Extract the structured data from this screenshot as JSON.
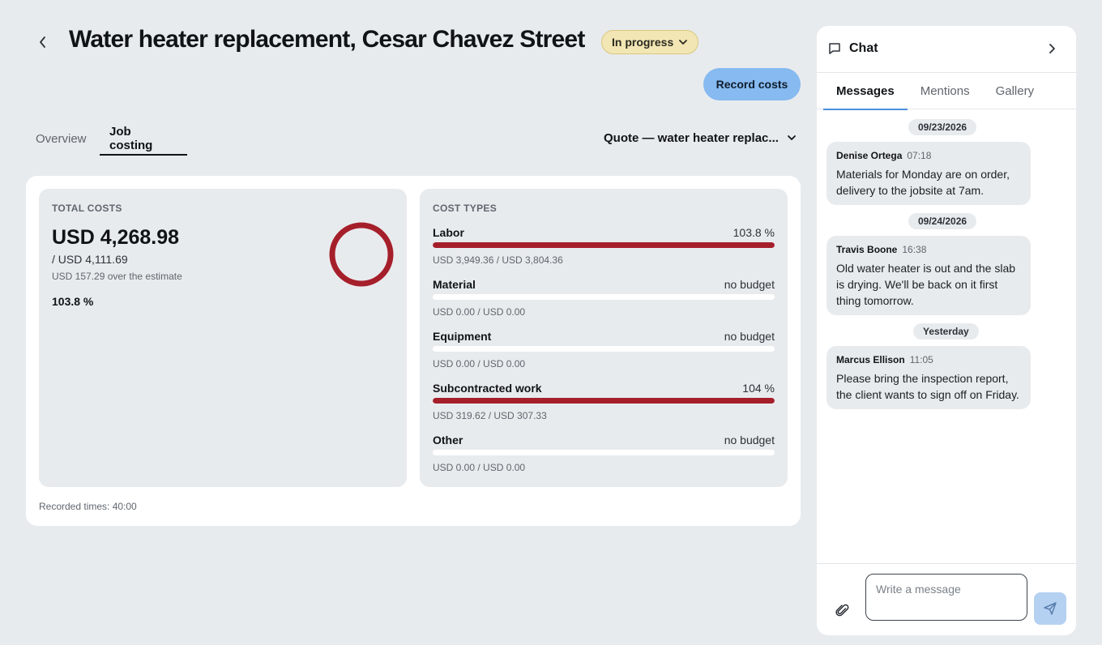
{
  "header": {
    "title": "Water heater replacement, Cesar Chavez Street",
    "status": "In progress",
    "record_costs_label": "Record costs"
  },
  "tabs": [
    {
      "label": "Overview",
      "active": false
    },
    {
      "label": "Job costing",
      "active": true
    }
  ],
  "quote_select": {
    "value": "Quote — water heater replac..."
  },
  "total_costs": {
    "label": "TOTAL COSTS",
    "amount": "USD 4,268.98",
    "budget": "/ USD 4,111.69",
    "over": "USD 157.29 over the estimate",
    "percent": "103.8 %",
    "percent_value": 103.8
  },
  "cost_types": {
    "label": "COST TYPES",
    "items": [
      {
        "name": "Labor",
        "pct": "103.8 %",
        "values": "USD 3,949.36 / USD 3,804.36",
        "fill": 1.0
      },
      {
        "name": "Material",
        "pct": "no budget",
        "values": "USD 0.00 / USD 0.00",
        "fill": 0
      },
      {
        "name": "Equipment",
        "pct": "no budget",
        "values": "USD 0.00 / USD 0.00",
        "fill": 0
      },
      {
        "name": "Subcontracted work",
        "pct": "104 %",
        "values": "USD 319.62 / USD 307.33",
        "fill": 1.0
      },
      {
        "name": "Other",
        "pct": "no budget",
        "values": "USD 0.00 / USD 0.00",
        "fill": 0
      }
    ]
  },
  "recorded_times": "Recorded times: 40:00",
  "colors": {
    "over_budget": "#a51f2b",
    "status_badge": "#f2e6b4",
    "primary_button": "#86baf0",
    "background": "#e8ebee"
  },
  "chat": {
    "title": "Chat",
    "tabs": [
      {
        "label": "Messages",
        "active": true
      },
      {
        "label": "Mentions",
        "active": false
      },
      {
        "label": "Gallery",
        "active": false
      }
    ],
    "dates": [
      "09/23/2026",
      "09/24/2026",
      "Yesterday"
    ],
    "messages": [
      {
        "author": "Denise Ortega",
        "time": "07:18",
        "text": "Materials for Monday are on order, delivery to the jobsite at 7am."
      },
      {
        "author": "Travis Boone",
        "time": "16:38",
        "text": "Old water heater is out and the slab is drying. We'll be back on it first thing tomorrow."
      },
      {
        "author": "Marcus Ellison",
        "time": "11:05",
        "text": "Please bring the inspection report, the client wants to sign off on Friday."
      }
    ],
    "input_placeholder": "Write a message",
    "icons": {
      "header": "chat-bubble-icon",
      "close": "chevron-right-icon",
      "attach": "paperclip-icon",
      "send": "send-icon"
    }
  }
}
